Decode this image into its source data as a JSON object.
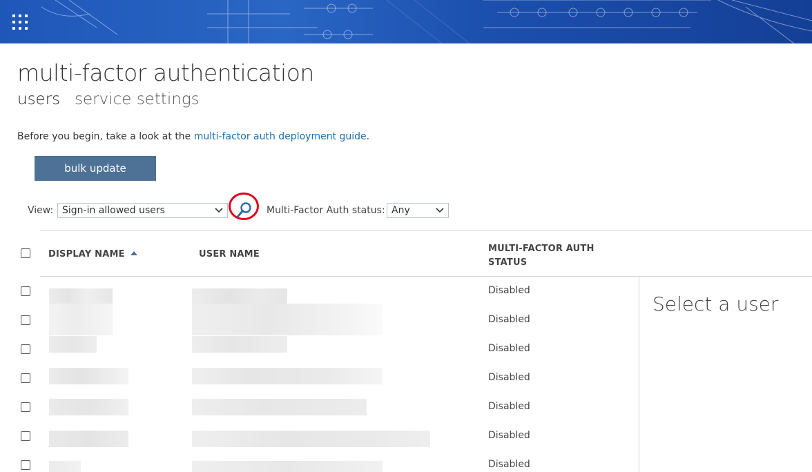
{
  "header": {
    "app_launcher": "app-launcher-icon"
  },
  "page": {
    "title": "multi-factor authentication",
    "tabs": [
      {
        "label": "users",
        "active": true
      },
      {
        "label": "service settings",
        "active": false
      }
    ],
    "intro_text": "Before you begin, take a look at the ",
    "intro_link": "multi-factor auth deployment guide",
    "intro_end": "."
  },
  "toolbar": {
    "bulk_update_label": "bulk update",
    "view_label": "View:",
    "view_value": "Sign-in allowed users",
    "mfa_status_label": "Multi-Factor Auth status:",
    "mfa_status_value": "Any"
  },
  "table": {
    "columns": {
      "display_name": "DISPLAY NAME",
      "user_name": "USER NAME",
      "mfa_status_line1": "MULTI-FACTOR AUTH",
      "mfa_status_line2": "STATUS"
    },
    "rows": [
      {
        "status": "Disabled"
      },
      {
        "status": "Disabled"
      },
      {
        "status": "Disabled"
      },
      {
        "status": "Disabled"
      },
      {
        "status": "Disabled"
      },
      {
        "status": "Disabled"
      },
      {
        "status": "Disabled"
      }
    ]
  },
  "detail_panel": {
    "placeholder": "Select a user"
  },
  "colors": {
    "accent": "#4e7295",
    "link": "#1a6fb0",
    "highlight": "#e0001a",
    "banner": "#1f57b8"
  }
}
